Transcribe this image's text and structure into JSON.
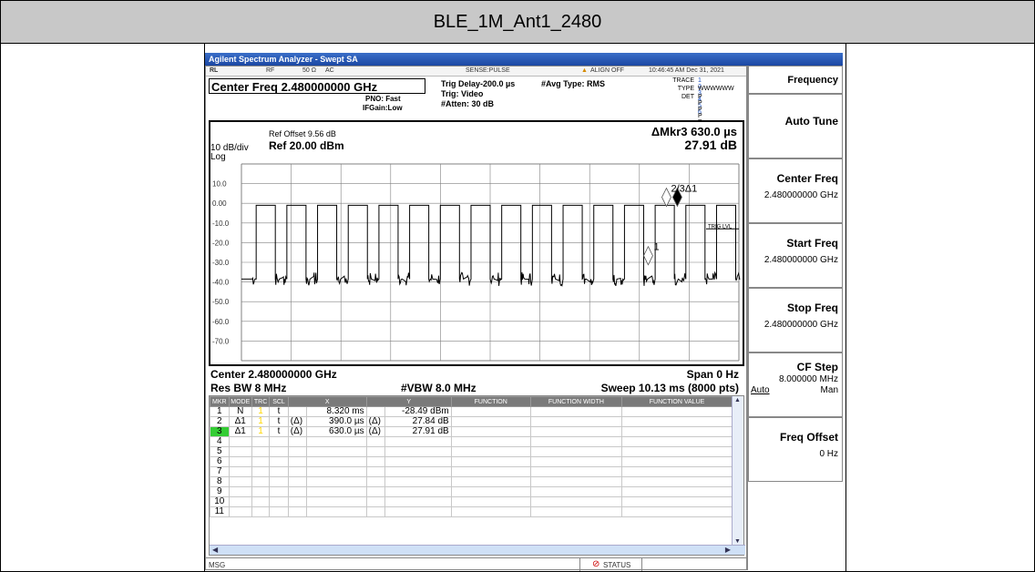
{
  "page_title": "BLE_1M_Ant1_2480",
  "app": {
    "window_title": "Agilent Spectrum Analyzer - Swept SA"
  },
  "status_bar": {
    "rl": "RL",
    "rf": "RF",
    "impedance": "50 Ω",
    "coupling": "AC",
    "sense": "SENSE:PULSE",
    "align": "ALIGN OFF",
    "datetime": "10:46:45 AM Dec 31, 2021"
  },
  "header": {
    "center_freq": "Center Freq 2.480000000 GHz",
    "pno": "PNO: Fast",
    "ifgain": "IFGain:Low",
    "trig_delay": "Trig Delay-200.0 µs",
    "trig": "Trig: Video",
    "atten": "#Atten: 30 dB",
    "avg_type": "#Avg Type: RMS",
    "trace_label": "TRACE",
    "trace_values": "1 2 3 4 5 6",
    "type_label": "TYPE",
    "type_values": "WWWWWW",
    "det_label": "DET",
    "det_values": "P P P P P P"
  },
  "plot": {
    "ref_offset": "Ref Offset 9.56 dB",
    "ref_level": "Ref 20.00 dBm",
    "scale": "10 dB/div",
    "log": "Log",
    "marker_readout": "ΔMkr3 630.0 µs",
    "marker_value": "27.91 dB",
    "trig_lvl": "TRIG LVL",
    "marker_labels": [
      "1",
      "2/3Δ1"
    ]
  },
  "chart_data": {
    "type": "line",
    "title": "",
    "xlabel": "",
    "ylabel": "",
    "yticks": [
      "10.0",
      "0.00",
      "-10.0",
      "-20.0",
      "-30.0",
      "-40.0",
      "-50.0",
      "-60.0",
      "-70.0"
    ],
    "ylim": [
      -80,
      20
    ],
    "xlim_ms": [
      0,
      10.13
    ],
    "grid": true,
    "pulse_period_ms": 0.625,
    "pulse_on_ms": 0.39,
    "pulse_high_dbm": -1.0,
    "pulse_low_dbm": -38.5,
    "trig_level_dbm": -13.0,
    "markers": [
      {
        "name": "1",
        "x_ms": 8.32,
        "y_dbm": -28.49
      },
      {
        "name": "2",
        "x_ms": 8.71,
        "y_dbm": -0.65
      },
      {
        "name": "3",
        "x_ms": 8.95,
        "y_dbm": -0.58
      }
    ]
  },
  "footer": {
    "center": "Center 2.480000000 GHz",
    "span": "Span 0 Hz",
    "res_bw": "Res BW 8 MHz",
    "vbw": "#VBW 8.0 MHz",
    "sweep": "Sweep  10.13 ms (8000 pts)"
  },
  "marker_table": {
    "headers": [
      "MKR",
      "MODE",
      "TRC",
      "SCL",
      "X",
      "Y",
      "FUNCTION",
      "FUNCTION WIDTH",
      "FUNCTION VALUE"
    ],
    "rows": [
      {
        "mkr": "1",
        "mode": "N",
        "trc": "1",
        "scl": "t",
        "xd": "",
        "x": "8.320 ms",
        "yd": "",
        "y": "-28.49 dBm"
      },
      {
        "mkr": "2",
        "mode": "Δ1",
        "trc": "1",
        "scl": "t",
        "xd": "(Δ)",
        "x": "390.0 µs",
        "yd": "(Δ)",
        "y": "27.84 dB"
      },
      {
        "mkr": "3",
        "mode": "Δ1",
        "trc": "1",
        "scl": "t",
        "xd": "(Δ)",
        "x": "630.0 µs",
        "yd": "(Δ)",
        "y": "27.91 dB"
      },
      {
        "mkr": "4"
      },
      {
        "mkr": "5"
      },
      {
        "mkr": "6"
      },
      {
        "mkr": "7"
      },
      {
        "mkr": "8"
      },
      {
        "mkr": "9"
      },
      {
        "mkr": "10"
      },
      {
        "mkr": "11"
      }
    ]
  },
  "bottom_bar": {
    "msg": "MSG",
    "status": "STATUS"
  },
  "softkeys": {
    "menu_title": "Frequency",
    "auto_tune": "Auto Tune",
    "center_freq": "Center Freq",
    "center_freq_val": "2.480000000 GHz",
    "start_freq": "Start Freq",
    "start_freq_val": "2.480000000 GHz",
    "stop_freq": "Stop Freq",
    "stop_freq_val": "2.480000000 GHz",
    "cf_step": "CF Step",
    "cf_step_val": "8.000000 MHz",
    "cf_auto": "Auto",
    "cf_man": "Man",
    "freq_offset": "Freq Offset",
    "freq_offset_val": "0 Hz"
  },
  "colors": {
    "trace": "#000000",
    "grid": "#808080",
    "title_bg": "#c8c8c8",
    "window_title_bg": "#2a5bb8",
    "trace_number": "#ffd700",
    "marker3_highlight": "#33cc33"
  }
}
